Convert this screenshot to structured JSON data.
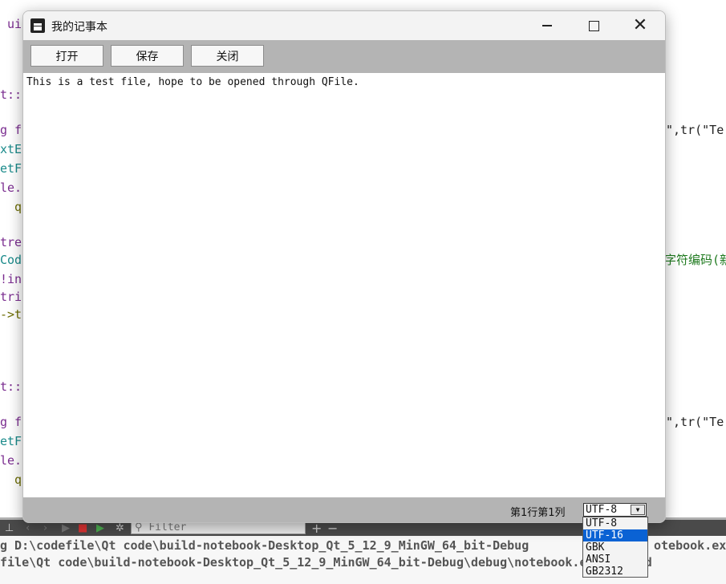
{
  "ide": {
    "code_lines": [
      {
        "text": " ui",
        "cls": "c-purple"
      },
      {
        "text": "t::",
        "cls": "c-purple"
      },
      {
        "text": "g f",
        "cls": "c-purple"
      },
      {
        "text": "xtE",
        "cls": "c-teal"
      },
      {
        "text": "etF",
        "cls": "c-teal"
      },
      {
        "text": "le.",
        "cls": "c-purple"
      },
      {
        "text": "  q",
        "cls": "c-olive"
      },
      {
        "text": "tre",
        "cls": "c-purple"
      },
      {
        "text": "Cod",
        "cls": "c-teal"
      },
      {
        "text": "!in",
        "cls": "c-purple"
      },
      {
        "text": "tri",
        "cls": "c-purple"
      },
      {
        "text": "->t",
        "cls": "c-olive"
      },
      {
        "text": "t::",
        "cls": "c-purple"
      },
      {
        "text": "g f",
        "cls": "c-purple"
      },
      {
        "text": "etF",
        "cls": "c-teal"
      },
      {
        "text": "le.",
        "cls": "c-purple"
      },
      {
        "text": "  q",
        "cls": "c-olive"
      }
    ],
    "right_fragments": [
      {
        "text": "\",tr(\"Te"
      },
      {
        "text": "字符编码(新"
      },
      {
        "text": "\",tr(\"Te"
      }
    ],
    "filter_placeholder": "Filter",
    "output_line_1": "g D:\\codefile\\Qt code\\build-notebook-Desktop_Qt_5_12_9_MinGW_64_bit-Debug",
    "output_line_1_tail": "otebook.ex",
    "output_line_2": "file\\Qt code\\build-notebook-Desktop_Qt_5_12_9_MinGW_64_bit-Debug\\debug\\notebook.exe exited"
  },
  "window": {
    "title": "我的记事本",
    "icon": "notepad-icon"
  },
  "toolbar": {
    "open_label": "打开",
    "save_label": "保存",
    "close_label": "关闭"
  },
  "editor": {
    "content": "This is a test file, hope to be opened through QFile."
  },
  "statusbar": {
    "position_text": "第1行第1列",
    "encoding_selected": "UTF-8",
    "encoding_options": [
      "UTF-8",
      "UTF-16",
      "GBK",
      "ANSI",
      "GB2312"
    ],
    "highlighted_option": "UTF-16"
  }
}
